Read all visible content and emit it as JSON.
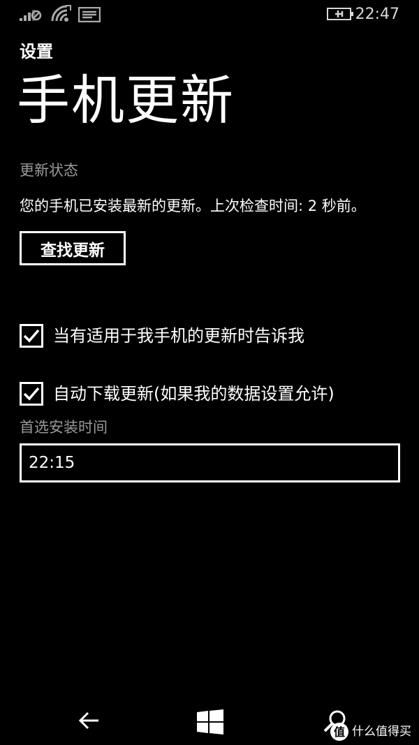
{
  "status_bar": {
    "time": "22:47",
    "icons": [
      "signal-icon",
      "wifi-icon",
      "message-icon",
      "battery-charging-icon"
    ]
  },
  "header": {
    "app_title": "设置",
    "page_title": "手机更新"
  },
  "update_status": {
    "label": "更新状态",
    "text": "您的手机已安装最新的更新。上次检查时间: 2 秒前。",
    "check_button_label": "查找更新"
  },
  "options": [
    {
      "label": "当有适用于我手机的更新时告诉我",
      "checked": true
    },
    {
      "label": "自动下载更新(如果我的数据设置允许)",
      "checked": true
    }
  ],
  "install_time": {
    "label": "首选安装时间",
    "value": "22:15"
  },
  "nav_bar": {
    "buttons": [
      "back-icon",
      "windows-icon",
      "search-icon"
    ]
  },
  "watermark": {
    "text": "什么值得买"
  },
  "colors": {
    "background": "#000000",
    "foreground": "#ffffff",
    "muted": "#9a9a9a"
  }
}
